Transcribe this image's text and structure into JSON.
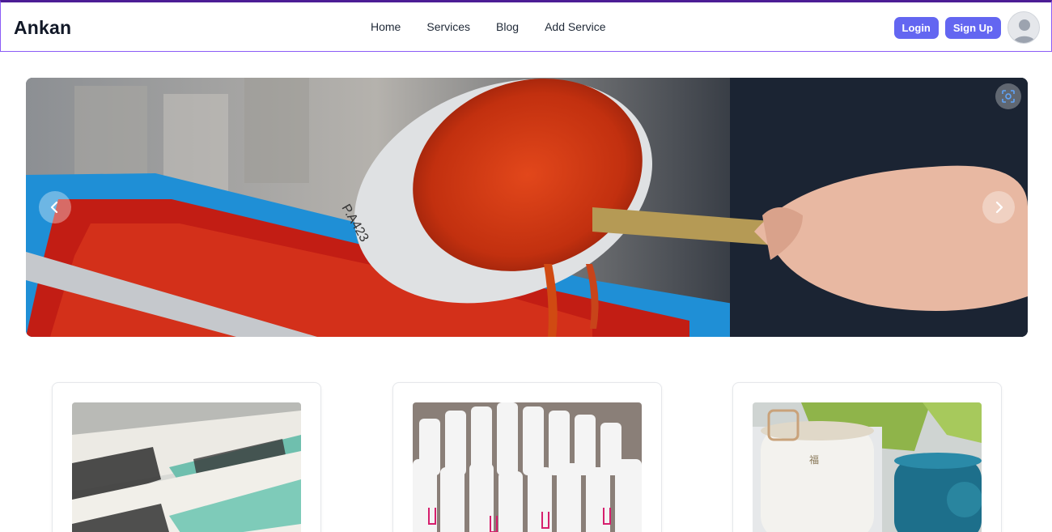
{
  "header": {
    "brand": "Ankan",
    "nav": [
      {
        "label": "Home"
      },
      {
        "label": "Services"
      },
      {
        "label": "Blog"
      },
      {
        "label": "Add Service"
      }
    ],
    "login_label": "Login",
    "signup_label": "Sign Up",
    "avatar_icon": "user-avatar-icon",
    "accent_color": "#6366f1",
    "border_color": "#8b5cf6"
  },
  "carousel": {
    "prev_icon": "chevron-left-icon",
    "next_icon": "chevron-right-icon",
    "scan_icon": "scan-icon",
    "slide_image": "paint-bucket-pouring-red-ink"
  },
  "cards": [
    {
      "image": "screen-print-sheets"
    },
    {
      "image": "white-bottles"
    },
    {
      "image": "tea-packaging"
    }
  ]
}
